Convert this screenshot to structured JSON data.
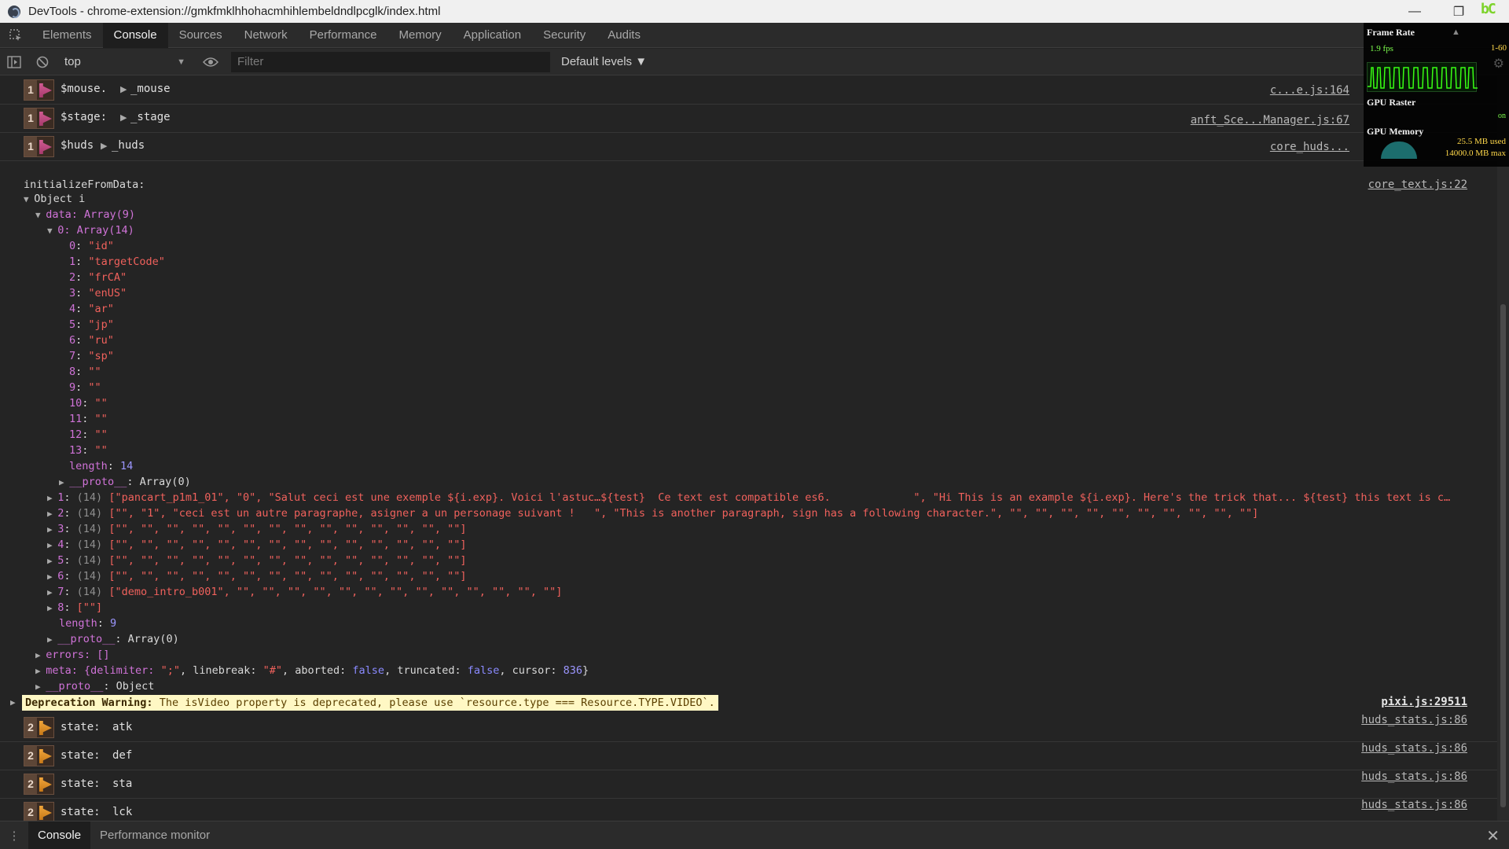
{
  "window": {
    "title": "DevTools - chrome-extension://gmkfmklhhohacmhihlembeldndlpcglk/index.html",
    "minimize": "—",
    "maximize": "❐",
    "logo": "bC"
  },
  "tabs": [
    "Elements",
    "Console",
    "Sources",
    "Network",
    "Performance",
    "Memory",
    "Application",
    "Security",
    "Audits"
  ],
  "active_tab": "Console",
  "toolbar": {
    "context": "top",
    "filter_placeholder": "Filter",
    "levels": "Default levels ▼"
  },
  "grouped_rows": [
    {
      "count": "1",
      "label": "$mouse.",
      "value": "_mouse",
      "source": "c...e.js:164"
    },
    {
      "count": "1",
      "label": "$stage:",
      "value": "_stage",
      "source": "anft_Sce...Manager.js:67"
    },
    {
      "count": "1",
      "label": "$huds",
      "value": "_huds",
      "source": "core_huds..."
    }
  ],
  "init_log": {
    "title": "initializeFromData:",
    "source": "core_text.js:22",
    "object_label": "Object",
    "data_label": "data: Array(9)",
    "item0_label": "0: Array(14)",
    "item0_entries": [
      {
        "k": "0",
        "v": "\"id\""
      },
      {
        "k": "1",
        "v": "\"targetCode\""
      },
      {
        "k": "2",
        "v": "\"frCA\""
      },
      {
        "k": "3",
        "v": "\"enUS\""
      },
      {
        "k": "4",
        "v": "\"ar\""
      },
      {
        "k": "5",
        "v": "\"jp\""
      },
      {
        "k": "6",
        "v": "\"ru\""
      },
      {
        "k": "7",
        "v": "\"sp\""
      },
      {
        "k": "8",
        "v": "\"\""
      },
      {
        "k": "9",
        "v": "\"\""
      },
      {
        "k": "10",
        "v": "\"\""
      },
      {
        "k": "11",
        "v": "\"\""
      },
      {
        "k": "12",
        "v": "\"\""
      },
      {
        "k": "13",
        "v": "\"\""
      }
    ],
    "item0_length": "14",
    "proto_array": "Array(0)",
    "arrays": [
      {
        "k": "1",
        "len": "(14)",
        "v": "[\"pancart_p1m1_01\", \"0\", \"Salut ceci est une exemple ${i.exp}. Voici l'astuc…${test}  Ce text est compatible es6.             \", \"Hi This is an example ${i.exp}. Here's the trick that... ${test} this text is c…"
      },
      {
        "k": "2",
        "len": "(14)",
        "v": "[\"\", \"1\", \"ceci est un autre paragraphe, asigner a un personage suivant !   \", \"This is another paragraph, sign has a following character.\", \"\", \"\", \"\", \"\", \"\", \"\", \"\", \"\", \"\", \"\"]"
      },
      {
        "k": "3",
        "len": "(14)",
        "v": "[\"\", \"\", \"\", \"\", \"\", \"\", \"\", \"\", \"\", \"\", \"\", \"\", \"\", \"\"]"
      },
      {
        "k": "4",
        "len": "(14)",
        "v": "[\"\", \"\", \"\", \"\", \"\", \"\", \"\", \"\", \"\", \"\", \"\", \"\", \"\", \"\"]"
      },
      {
        "k": "5",
        "len": "(14)",
        "v": "[\"\", \"\", \"\", \"\", \"\", \"\", \"\", \"\", \"\", \"\", \"\", \"\", \"\", \"\"]"
      },
      {
        "k": "6",
        "len": "(14)",
        "v": "[\"\", \"\", \"\", \"\", \"\", \"\", \"\", \"\", \"\", \"\", \"\", \"\", \"\", \"\"]"
      },
      {
        "k": "7",
        "len": "(14)",
        "v": "[\"demo_intro_b001\", \"\", \"\", \"\", \"\", \"\", \"\", \"\", \"\", \"\", \"\", \"\", \"\", \"\"]"
      },
      {
        "k": "8",
        "len": "",
        "v": "[\"\"]"
      }
    ],
    "data_length": "9",
    "errors": "errors: []",
    "meta": {
      "prefix": "meta: {delimiter: ",
      "delimiter": "\";\"",
      "mid1": ", linebreak: ",
      "linebreak": "\"#\"",
      "mid2": ", aborted: ",
      "aborted": "false",
      "mid3": ", truncated: ",
      "truncated": "false",
      "mid4": ", cursor: ",
      "cursor": "836",
      "suffix": "}"
    },
    "proto_object": "Object"
  },
  "warning": {
    "label": "Deprecation Warning:",
    "text": " The isVideo property is deprecated, please use `resource.type === Resource.TYPE.VIDEO`.",
    "source": "pixi.js:29511"
  },
  "state_rows": [
    {
      "count": "2",
      "label": "state:",
      "value": "atk",
      "source": "huds_stats.js:86"
    },
    {
      "count": "2",
      "label": "state:",
      "value": "def",
      "source": "huds_stats.js:86"
    },
    {
      "count": "2",
      "label": "state:",
      "value": "sta",
      "source": "huds_stats.js:86"
    },
    {
      "count": "2",
      "label": "state:",
      "value": "lck",
      "source": "huds_stats.js:86"
    }
  ],
  "perf_overlay": {
    "frame_rate_label": "Frame Rate",
    "fps": "1.9 fps",
    "range": "1-60",
    "gpu_raster_label": "GPU Raster",
    "gpu_raster_status": "on",
    "gpu_memory_label": "GPU Memory",
    "gpu_mem_used": "25.5 MB used",
    "gpu_mem_max": "14000.0 MB max"
  },
  "drawer": {
    "tabs": [
      "Console",
      "Performance monitor"
    ],
    "active": "Console",
    "close": "✕"
  }
}
